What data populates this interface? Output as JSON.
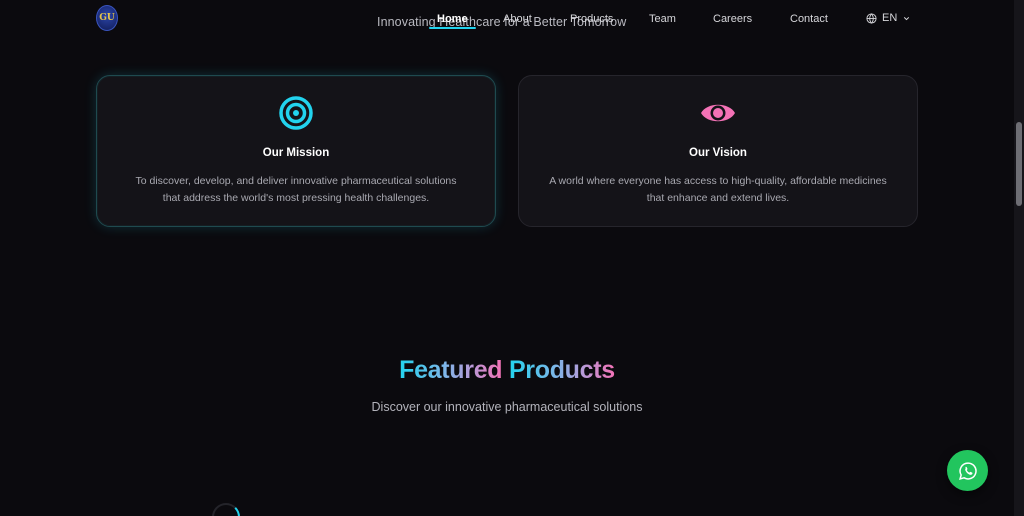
{
  "header": {
    "logo_text": "GU",
    "tagline": "Innovating Healthcare for a Better Tomorrow",
    "nav": [
      {
        "label": "Home",
        "active": true
      },
      {
        "label": "About",
        "active": false
      },
      {
        "label": "Products",
        "active": false
      },
      {
        "label": "Team",
        "active": false
      },
      {
        "label": "Careers",
        "active": false
      },
      {
        "label": "Contact",
        "active": false
      }
    ],
    "language": {
      "icon": "globe-icon",
      "label": "EN",
      "chevron": "chevron-down-icon"
    }
  },
  "cards": [
    {
      "icon": "target-icon",
      "title": "Our Mission",
      "text": "To discover, develop, and deliver innovative pharmaceutical solutions that address the world's most pressing health challenges."
    },
    {
      "icon": "eye-icon",
      "title": "Our Vision",
      "text": "A world where everyone has access to high-quality, affordable medicines that enhance and extend lives."
    }
  ],
  "featured": {
    "title_part1": "Featured",
    "title_part2": "Products",
    "subtitle": "Discover our innovative pharmaceutical solutions"
  },
  "colors": {
    "background": "#0b0a0e",
    "accent_cyan": "#22d3ee",
    "accent_pink": "#f472b6",
    "whatsapp_green": "#22c55e"
  },
  "floating_button": {
    "icon": "whatsapp-icon"
  }
}
